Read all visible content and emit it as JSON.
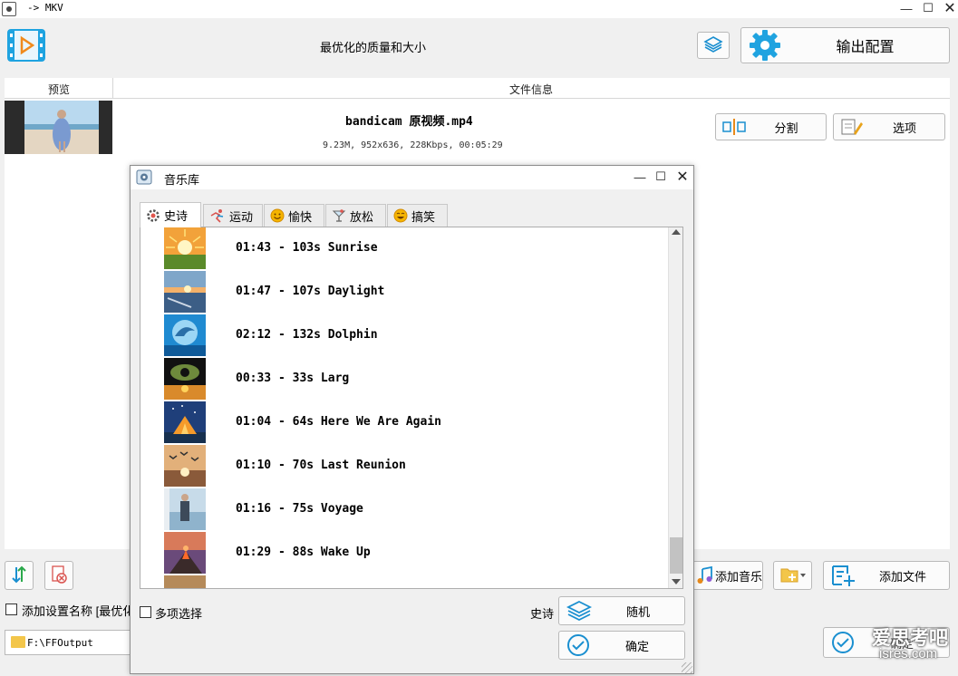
{
  "window": {
    "title": "-> MKV"
  },
  "toolbar": {
    "preset_label": "最优化的质量和大小",
    "output_config_label": "输出配置"
  },
  "file_list": {
    "headers": {
      "preview": "预览",
      "file_info": "文件信息"
    },
    "file": {
      "name": "bandicam 原视频.mp4",
      "meta": "9.23M, 952x636, 228Kbps, 00:05:29"
    },
    "split_label": "分割",
    "options_label": "选项"
  },
  "bottom": {
    "add_setting_name_label": "添加设置名称 [最优化",
    "add_music_label": "添加音乐",
    "add_file_label": "添加文件",
    "output_path": "F:\\FFOutput",
    "ok_label": "确定"
  },
  "dialog": {
    "title": "音乐库",
    "tabs": [
      {
        "label": "史诗",
        "icon": "gear-icon",
        "active": true
      },
      {
        "label": "运动",
        "icon": "running-icon",
        "active": false
      },
      {
        "label": "愉快",
        "icon": "smile-icon",
        "active": false
      },
      {
        "label": "放松",
        "icon": "cocktail-icon",
        "active": false
      },
      {
        "label": "搞笑",
        "icon": "laugh-icon",
        "active": false
      }
    ],
    "tracks": [
      {
        "label": "01:43 - 103s Sunrise",
        "thumb": "sunrise"
      },
      {
        "label": "01:47 - 107s Daylight",
        "thumb": "daylight"
      },
      {
        "label": "02:12 - 132s Dolphin",
        "thumb": "dolphin"
      },
      {
        "label": "00:33 - 33s Larg",
        "thumb": "eye"
      },
      {
        "label": "01:04 - 64s Here We Are Again",
        "thumb": "tent"
      },
      {
        "label": "01:10 - 70s Last Reunion",
        "thumb": "birds"
      },
      {
        "label": "01:16 - 75s Voyage",
        "thumb": "voyage"
      },
      {
        "label": "01:29 - 88s Wake Up",
        "thumb": "volcano"
      }
    ],
    "multi_select_label": "多项选择",
    "current_category": "史诗",
    "random_label": "随机",
    "ok_label": "确定"
  },
  "watermark": {
    "line1": "爱思考吧",
    "line2": "isres.com"
  }
}
